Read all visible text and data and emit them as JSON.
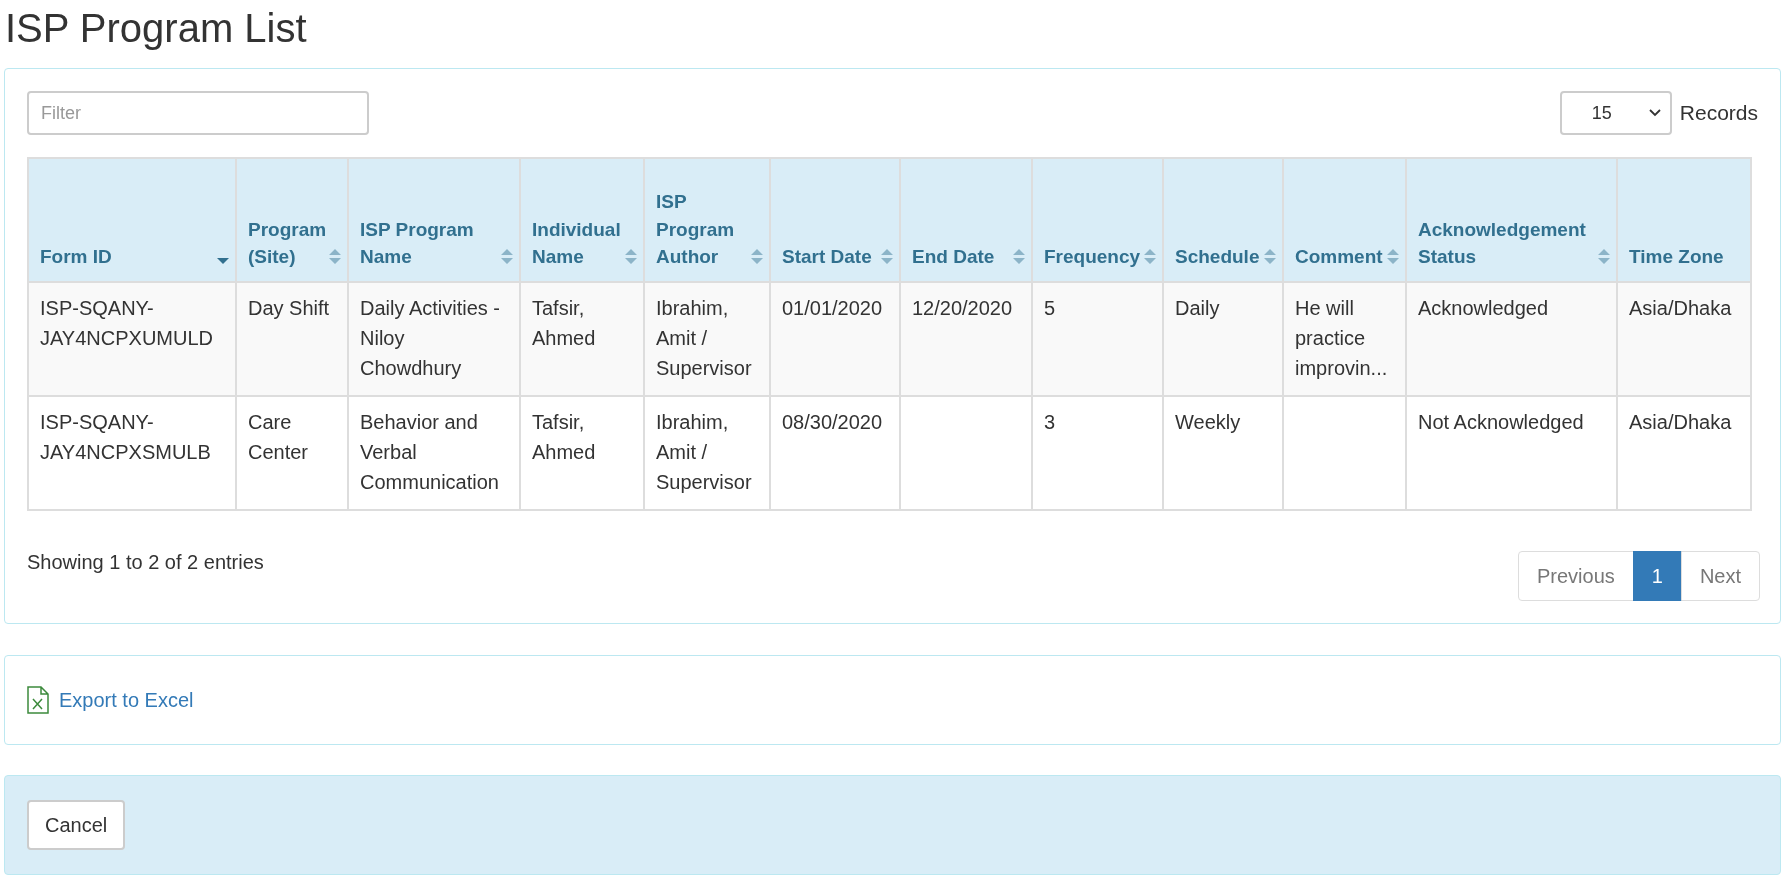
{
  "page": {
    "title": "ISP Program List"
  },
  "filter": {
    "placeholder": "Filter"
  },
  "records": {
    "value": "15",
    "label": "Records"
  },
  "table": {
    "columns": [
      {
        "label": "Form ID",
        "kind": "sorted"
      },
      {
        "label": "Program (Site)",
        "kind": "sortable"
      },
      {
        "label": "ISP Program Name",
        "kind": "sortable"
      },
      {
        "label": "Individual Name",
        "kind": "sortable"
      },
      {
        "label": "ISP Program Author",
        "kind": "sortable"
      },
      {
        "label": "Start Date",
        "kind": "sortable"
      },
      {
        "label": "End Date",
        "kind": "sortable"
      },
      {
        "label": "Frequency",
        "kind": "sortable"
      },
      {
        "label": "Schedule",
        "kind": "sortable"
      },
      {
        "label": "Comment",
        "kind": "sortable"
      },
      {
        "label": "Acknowledgement Status",
        "kind": "sortable"
      },
      {
        "label": "Time Zone",
        "kind": "plain"
      }
    ],
    "rows": [
      [
        "ISP-SQANY-JAY4NCPXUMULD",
        "Day Shift",
        "Daily Activities - Niloy Chowdhury",
        "Tafsir, Ahmed",
        "Ibrahim, Amit / Supervisor",
        "01/01/2020",
        "12/20/2020",
        "5",
        "Daily",
        "He will practice improvin...",
        "Acknowledged",
        "Asia/Dhaka"
      ],
      [
        "ISP-SQANY-JAY4NCPXSMULB",
        "Care Center",
        "Behavior and Verbal Communication",
        "Tafsir, Ahmed",
        "Ibrahim, Amit / Supervisor",
        "08/30/2020",
        "",
        "3",
        "Weekly",
        "",
        "Not Acknowledged",
        "Asia/Dhaka"
      ]
    ]
  },
  "info": "Showing 1 to 2 of 2 entries",
  "pagination": [
    {
      "label": "Previous",
      "selected": false
    },
    {
      "label": "1",
      "selected": true
    },
    {
      "label": "Next",
      "selected": false
    }
  ],
  "export": {
    "label": "Export to Excel"
  },
  "buttons": [
    "Cancel"
  ]
}
